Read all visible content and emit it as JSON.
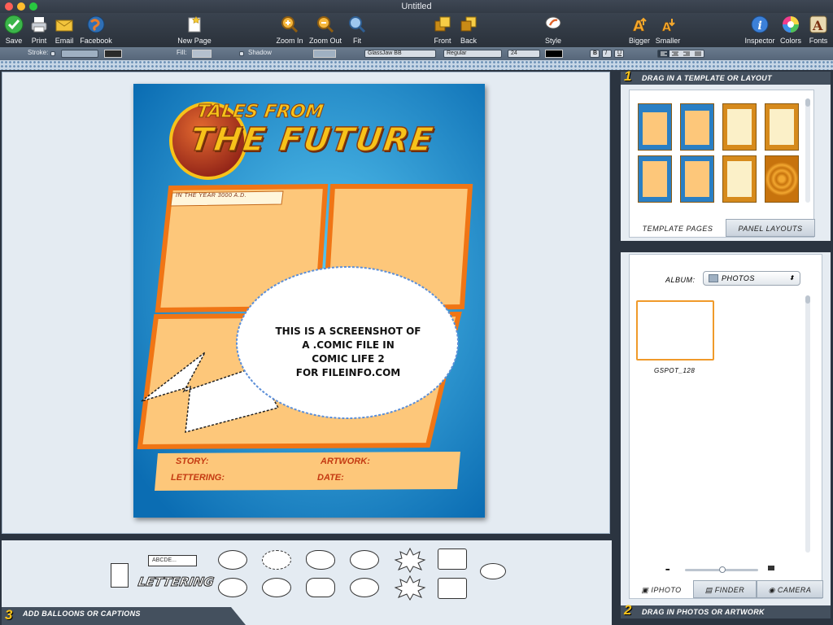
{
  "window": {
    "title": "Untitled"
  },
  "toolbar": {
    "save": "Save",
    "print": "Print",
    "email": "Email",
    "facebook": "Facebook",
    "new_page": "New Page",
    "zoom_in": "Zoom In",
    "zoom_out": "Zoom Out",
    "fit": "Fit",
    "front": "Front",
    "back": "Back",
    "style": "Style",
    "bigger": "Bigger",
    "smaller": "Smaller",
    "inspector": "Inspector",
    "colors": "Colors",
    "fonts": "Fonts"
  },
  "format_bar": {
    "stroke_label": "Stroke:",
    "fill_label": "Fill:",
    "shadow_label": "Shadow",
    "font_name": "GlassJaw BB",
    "font_style": "Regular",
    "font_size": "24",
    "bold": "B",
    "italic": "I",
    "underline": "U"
  },
  "comic_page": {
    "title_line1": "TALES FROM",
    "title_line2": "THE FUTURE",
    "caption": "IN THE YEAR 3000 A.D.",
    "balloon_text_1": "THIS IS A SCREENSHOT OF",
    "balloon_text_2": "A .COMIC FILE IN",
    "balloon_text_3": "COMIC LIFE 2",
    "balloon_text_4": "FOR FILEINFO.COM",
    "story_label": "STORY:",
    "artwork_label": "ARTWORK:",
    "lettering_label": "LETTERING:",
    "date_label": "DATE:"
  },
  "panel_templates": {
    "number": "1",
    "header": "DRAG IN A TEMPLATE OR LAYOUT",
    "tab_template_pages": "TEMPLATE PAGES",
    "tab_panel_layouts": "PANEL LAYOUTS"
  },
  "panel_photos": {
    "number": "2",
    "header": "DRAG IN PHOTOS OR ARTWORK",
    "album_label": "ALBUM:",
    "album_value": "PHOTOS",
    "photo_name": "GSPOT_128",
    "tab_iphoto": "IPHOTO",
    "tab_finder": "FINDER",
    "tab_camera": "CAMERA"
  },
  "panel_balloons": {
    "number": "3",
    "header": "ADD BALLOONS OR CAPTIONS",
    "caption_sample": "ABCDE...",
    "lettering_sample": "LETTERING"
  },
  "colors": {
    "page_blue": "#1c86c8",
    "panel_fill": "#fdc77a",
    "panel_stroke": "#f07515",
    "title_yellow": "#f7c21a",
    "label_red": "#c43a12"
  }
}
